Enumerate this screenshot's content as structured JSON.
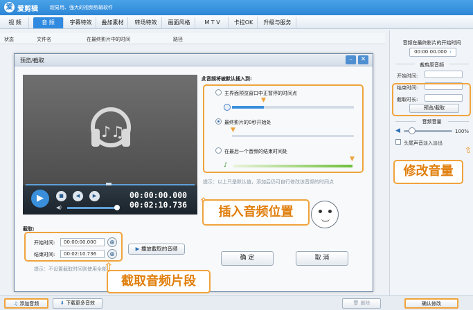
{
  "app": {
    "name": "爱剪辑",
    "slogan": "超易用、强大的视频剪辑软件",
    "logo_char": "爱"
  },
  "tabs": [
    "视 频",
    "音 频",
    "字幕特效",
    "叠加素材",
    "转场特效",
    "画面风格",
    "M T V",
    "卡拉OK",
    "升级与服务"
  ],
  "active_tab": "音 频",
  "columns": [
    "状态",
    "文件名",
    "在最终影片中的时间",
    "路径"
  ],
  "right_panel": {
    "insert_time_title": "音频在最终影片的开始时间",
    "insert_time_value": "00:00:00.000",
    "clip_title": "裁剪原音频",
    "start_label": "开始时间:",
    "end_label": "结束时间:",
    "duration_label": "截取时长:",
    "preview_button": "预览/截取",
    "volume_title": "音频音量",
    "volume_value": "100%",
    "fade_label": "头尾声音淡入淡出",
    "confirm_button": "确认修改"
  },
  "dialog": {
    "title": "预览/截取",
    "timecode_current": "00:00:00.000",
    "timecode_total": "00:02:10.736",
    "clip_heading": "截取:",
    "start_label": "开始时间:",
    "start_value": "00:00:00.000",
    "end_label": "结束时间:",
    "end_value": "00:02:10.736",
    "play_clip_button": "播放截取的音频",
    "hint": "提示：不设置截取时间则使用全部",
    "insert_heading": "此音频将被默认插入到:",
    "options": [
      "主界面预览窗口中正暂停的时间点",
      "最终影片的0秒开始处",
      "在最后一个音频的结束时间处"
    ],
    "selected_option": 1,
    "note": "提示：以上只是默认值，添加后仍可自行修改该音频的时间点",
    "ok_button": "确 定",
    "cancel_button": "取 消"
  },
  "callouts": {
    "volume": "修改音量",
    "position": "插入音频位置",
    "clip": "截取音频片段"
  },
  "bottom": {
    "add_audio": "添加音频",
    "download_more": "下载更多音效",
    "delete": "删除"
  },
  "colors": {
    "accent": "#2f8ae0",
    "highlight": "#f0a33c",
    "callout_text": "#e07f0e"
  }
}
